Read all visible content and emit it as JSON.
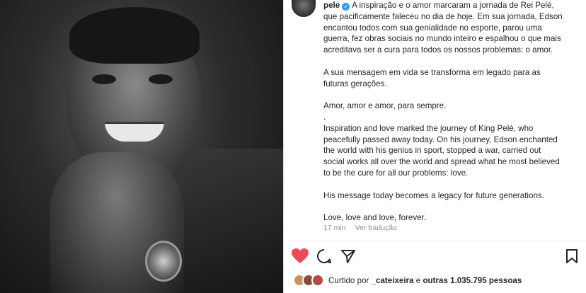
{
  "post": {
    "username": "pele",
    "caption_pt": [
      "A inspiração e o amor marcaram a jornada de Rei Pelé,",
      "que pacificamente faleceu no dia de hoje. Em sua jornada, Edson",
      "encantou todos com sua genialidade no esporte, parou uma",
      "guerra, fez obras sociais no mundo inteiro e espalhou o que mais",
      "acreditava ser a cura para todos os nossos problemas: o amor."
    ],
    "caption_pt_2": [
      "A sua mensagem em vida se transforma em legado para as",
      "futuras gerações."
    ],
    "caption_pt_3": "Amor, amor e amor, para sempre.",
    "separator": ".",
    "caption_en": [
      "Inspiration and love marked the journey of King Pelé, who",
      "peacefully passed away today. On his journey, Edson enchanted",
      "the world with his genius in sport, stopped a war, carried out",
      "social works all over the world and spread what he most believed",
      "to be the cure for all our problems: love."
    ],
    "caption_en_2": "His message today becomes a legacy for future generations.",
    "caption_en_3": "Love, love and love, forever.",
    "time_ago": "17 min",
    "translate_label": "Ver tradução"
  },
  "actions": {
    "like_icon": "heart-filled-icon",
    "comment_icon": "comment-icon",
    "share_icon": "paper-plane-icon",
    "save_icon": "bookmark-icon",
    "like_color": "#ed4956"
  },
  "likes": {
    "prefix": "Curtido por",
    "user": "_cateixeira",
    "connector": "e",
    "others": "outras 1.035.795 pessoas"
  },
  "colors": {
    "verified": "#3897f0",
    "muted": "#8e8e8e",
    "text": "#262626"
  }
}
